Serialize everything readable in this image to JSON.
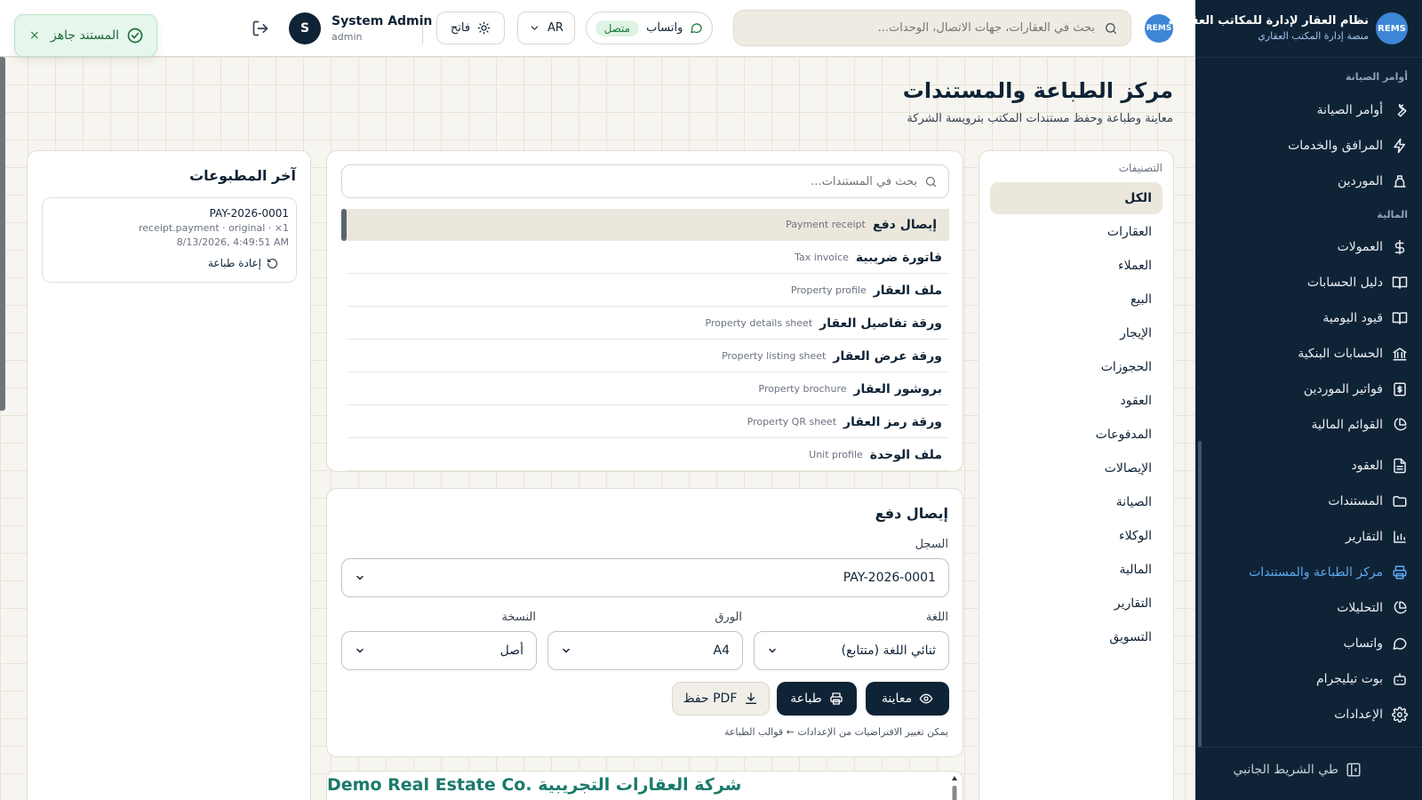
{
  "colors": {
    "sidebar_bg": "#0f2336",
    "accent": "#5ea9f2",
    "success": "#1b7a3a",
    "brand_teal": "#1a7a6b"
  },
  "brand": {
    "logo_text": "REMS",
    "title": "نظام العقار لإدارة للمكاتب العقارية",
    "subtitle": "منصة إدارة المكتب العقاري"
  },
  "sidebar": {
    "groups": [
      {
        "label": "أوامر الصيانة"
      },
      {
        "label": "المالية"
      }
    ],
    "items": [
      {
        "label": "أوامر الصيانة",
        "icon": "wrench-icon"
      },
      {
        "label": "المرافق والخدمات",
        "icon": "bolt-icon"
      },
      {
        "label": "الموردين",
        "icon": "supplier-icon"
      },
      {
        "label": "العمولات",
        "icon": "dollar-icon"
      },
      {
        "label": "دليل الحسابات",
        "icon": "book-icon"
      },
      {
        "label": "قيود اليومية",
        "icon": "book-open-icon"
      },
      {
        "label": "الحسابات البنكية",
        "icon": "bank-icon"
      },
      {
        "label": "فواتير الموردين",
        "icon": "invoice-icon"
      },
      {
        "label": "القوائم المالية",
        "icon": "pie-chart-icon"
      },
      {
        "label": "العقود",
        "icon": "file-text-icon"
      },
      {
        "label": "المستندات",
        "icon": "folder-icon"
      },
      {
        "label": "التقارير",
        "icon": "bar-chart-icon"
      },
      {
        "label": "مركز الطباعة والمستندات",
        "icon": "printer-icon",
        "active": true
      },
      {
        "label": "التحليلات",
        "icon": "analytics-icon"
      },
      {
        "label": "واتساب",
        "icon": "chat-icon"
      },
      {
        "label": "بوت تيليجرام",
        "icon": "bot-icon"
      },
      {
        "label": "الإعدادات",
        "icon": "gear-icon"
      }
    ],
    "collapse_label": "طي الشريط الجانبي"
  },
  "header": {
    "search_placeholder": "بحث في العقارات، جهات الاتصال، الوحدات...",
    "whatsapp_label": "واتساب",
    "whatsapp_status": "متصل",
    "language": "AR",
    "theme_label": "فاتح",
    "user_name": "System Admin",
    "user_role": "admin",
    "avatar_initial": "S"
  },
  "toast": {
    "message": "المستند جاهز",
    "close": "×"
  },
  "page": {
    "title": "مركز الطباعة والمستندات",
    "subtitle": "معاينة وطباعة وحفظ مستندات المكتب بترويسة الشركة"
  },
  "categories": {
    "label": "التصنيفات",
    "items": [
      {
        "label": "الكل",
        "active": true
      },
      {
        "label": "العقارات"
      },
      {
        "label": "العملاء"
      },
      {
        "label": "البيع"
      },
      {
        "label": "الإيجار"
      },
      {
        "label": "الحجوزات"
      },
      {
        "label": "العقود"
      },
      {
        "label": "المدفوعات"
      },
      {
        "label": "الإيصالات"
      },
      {
        "label": "الصيانة"
      },
      {
        "label": "الوكلاء"
      },
      {
        "label": "المالية"
      },
      {
        "label": "التقارير"
      },
      {
        "label": "التسويق"
      }
    ]
  },
  "documents": {
    "search_placeholder": "بحث في المستندات...",
    "items": [
      {
        "ar": "إيصال دفع",
        "en": "Payment receipt",
        "active": true
      },
      {
        "ar": "فاتورة ضريبية",
        "en": "Tax invoice"
      },
      {
        "ar": "ملف العقار",
        "en": "Property profile"
      },
      {
        "ar": "ورقة تفاصيل العقار",
        "en": "Property details sheet"
      },
      {
        "ar": "ورقة عرض العقار",
        "en": "Property listing sheet"
      },
      {
        "ar": "بروشور العقار",
        "en": "Property brochure"
      },
      {
        "ar": "ورقة رمز العقار",
        "en": "Property QR sheet"
      },
      {
        "ar": "ملف الوحدة",
        "en": "Unit profile"
      }
    ]
  },
  "form": {
    "title": "إيصال دفع",
    "record_label": "السجل",
    "record_value": "PAY-2026-0001",
    "language_label": "اللغة",
    "language_value": "ثنائي اللغة (متتابع)",
    "paper_label": "الورق",
    "paper_value": "A4",
    "copy_label": "النسخة",
    "copy_value": "أصل",
    "preview_button": "معاينة",
    "print_button": "طباعة",
    "pdf_button": "حفظ PDF",
    "note": "يمكن تغيير الافتراضيات من الإعدادات ← قوالب الطباعة"
  },
  "preview": {
    "company_name": "Demo Real Estate Co. شركة العقارات التجريبية"
  },
  "recent": {
    "title": "آخر المطبوعات",
    "items": [
      {
        "id": "PAY-2026-0001",
        "meta": "receipt.payment · original · ×1",
        "date": "8/13/2026, 4:49:51 AM",
        "reprint_label": "إعادة طباعة"
      }
    ]
  }
}
